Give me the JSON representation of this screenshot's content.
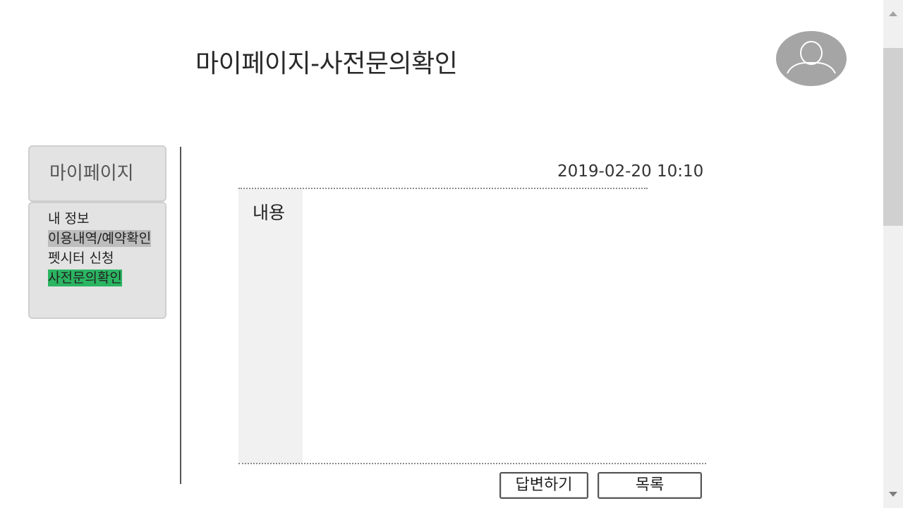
{
  "header": {
    "title": "마이페이지-사전문의확인",
    "avatar_icon": "user-avatar-icon"
  },
  "sidebar": {
    "title": "마이페이지",
    "items": [
      {
        "label": "내 정보",
        "state": "normal"
      },
      {
        "label": "이용내역/예약확인",
        "state": "hover"
      },
      {
        "label": "펫시터 신청",
        "state": "normal"
      },
      {
        "label": "사전문의확인",
        "state": "active",
        "active_color": "#2bb562"
      }
    ]
  },
  "inquiry": {
    "date": "2019-02-20 10:10",
    "content_label": "내용",
    "content_text": ""
  },
  "actions": {
    "reply_label": "답변하기",
    "list_label": "목록"
  },
  "scrollbar": {
    "up_icon": "scroll-up-arrow-icon",
    "down_icon": "scroll-down-arrow-icon"
  }
}
